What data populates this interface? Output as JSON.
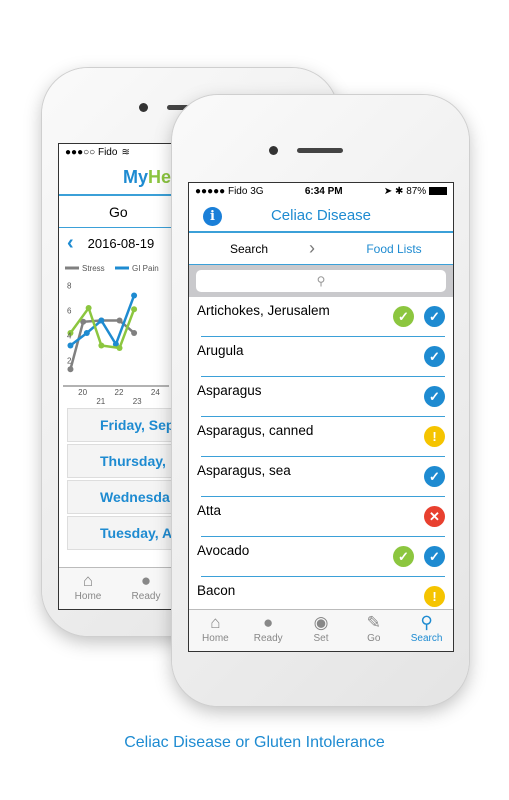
{
  "back_phone": {
    "status": {
      "carrier": "●●●○○ Fido",
      "wifi_icon": "wifi-icon"
    },
    "app_title_part1": "My",
    "app_title_part2": "He",
    "segment": "Go",
    "date": "2016-08-19",
    "day_rows": [
      "Friday, Sep",
      "Thursday,",
      "Wednesda",
      "Tuesday, A"
    ],
    "tabs": [
      {
        "label": "Home",
        "icon": "home-icon"
      },
      {
        "label": "Ready",
        "icon": "apple-icon"
      }
    ],
    "chart_data": {
      "type": "line",
      "x_ticks": [
        20,
        21,
        22,
        23,
        24
      ],
      "y_ticks": [
        2,
        4,
        6,
        8
      ],
      "xlim": [
        19,
        24.5
      ],
      "ylim": [
        1,
        9
      ],
      "series": [
        {
          "name": "Stress",
          "color": "#808080",
          "x": [
            19.3,
            20,
            21,
            22,
            22.8
          ],
          "y": [
            1.7,
            5.5,
            5.6,
            5.6,
            4.6
          ]
        },
        {
          "name": "GI Pain",
          "color": "#1e8bd1",
          "x": [
            19.3,
            20.2,
            21,
            21.8,
            22.8
          ],
          "y": [
            3.6,
            4.6,
            5.6,
            3.7,
            7.6
          ]
        },
        {
          "color": "#8cc63f",
          "x": [
            19.3,
            20.3,
            21,
            22,
            22.8
          ],
          "y": [
            4.6,
            6.6,
            3.6,
            3.4,
            6.5
          ]
        }
      ]
    }
  },
  "front_phone": {
    "status": {
      "carrier": "●●●●● Fido  3G",
      "time": "6:34 PM",
      "battery": "87%"
    },
    "title": "Celiac Disease",
    "segments": {
      "left": "Search",
      "right": "Food Lists"
    },
    "search_placeholder": "",
    "foods": [
      {
        "name": "Artichokes, Jerusalem",
        "icons": [
          "green-check",
          "blue-check"
        ]
      },
      {
        "name": "Arugula",
        "icons": [
          "blue-check"
        ]
      },
      {
        "name": "Asparagus",
        "icons": [
          "blue-check"
        ]
      },
      {
        "name": "Asparagus, canned",
        "icons": [
          "yellow-warning"
        ]
      },
      {
        "name": "Asparagus, sea",
        "icons": [
          "blue-check"
        ]
      },
      {
        "name": "Atta",
        "icons": [
          "red-x"
        ]
      },
      {
        "name": "Avocado",
        "icons": [
          "green-check",
          "blue-check"
        ]
      },
      {
        "name": "Bacon",
        "icons": [
          "yellow-warning"
        ]
      }
    ],
    "tabs": [
      {
        "label": "Home",
        "icon": "home-icon"
      },
      {
        "label": "Ready",
        "icon": "apple-icon"
      },
      {
        "label": "Set",
        "icon": "plate-icon"
      },
      {
        "label": "Go",
        "icon": "notebook-icon"
      },
      {
        "label": "Search",
        "icon": "search-icon",
        "active": true
      }
    ]
  },
  "caption": "Celiac Disease or Gluten Intolerance",
  "colors": {
    "accent": "#1e8bd1",
    "green": "#8cc63f",
    "yellow": "#f5c400",
    "red": "#e8402f"
  }
}
